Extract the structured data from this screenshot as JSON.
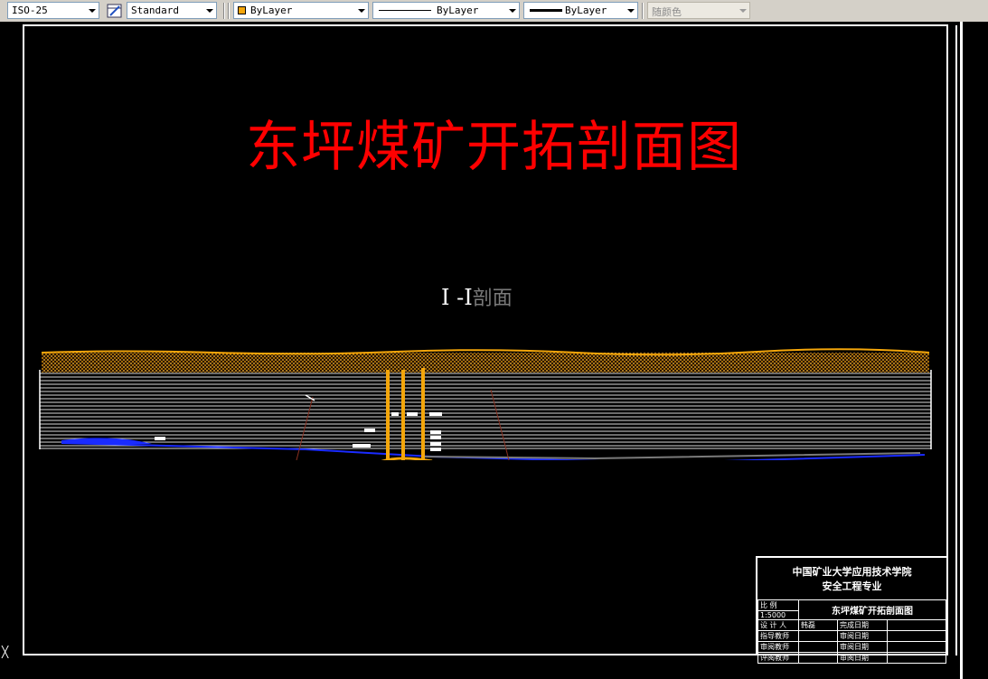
{
  "toolbar": {
    "dim_style": "ISO-25",
    "table_style": "Standard",
    "layer_color": "ByLayer",
    "linetype": "ByLayer",
    "lineweight": "ByLayer",
    "plot_style": "随颜色",
    "colors": {
      "swatch": "#f4a60a"
    }
  },
  "drawing": {
    "title": "东坪煤矿开拓剖面图",
    "section_label": "I -I",
    "section_suffix": "剖面",
    "colors": {
      "title": "#ff0000",
      "orange": "#f4a60a",
      "blue": "#1a2bff",
      "background": "#000000"
    }
  },
  "title_block": {
    "school_line1": "中国矿业大学应用技术学院",
    "school_line2": "安全工程专业",
    "scale_label": "比   例",
    "scale_value": "1:5000",
    "drawing_name": "东坪煤矿开拓剖面图",
    "rows": [
      {
        "label": "设 计 人",
        "name": "韩磊",
        "date_label": "完成日期"
      },
      {
        "label": "指导教师",
        "name": "",
        "date_label": "审阅日期"
      },
      {
        "label": "审阅教师",
        "name": "",
        "date_label": "审阅日期"
      },
      {
        "label": "评阅教师",
        "name": "",
        "date_label": "审阅日期"
      }
    ]
  }
}
